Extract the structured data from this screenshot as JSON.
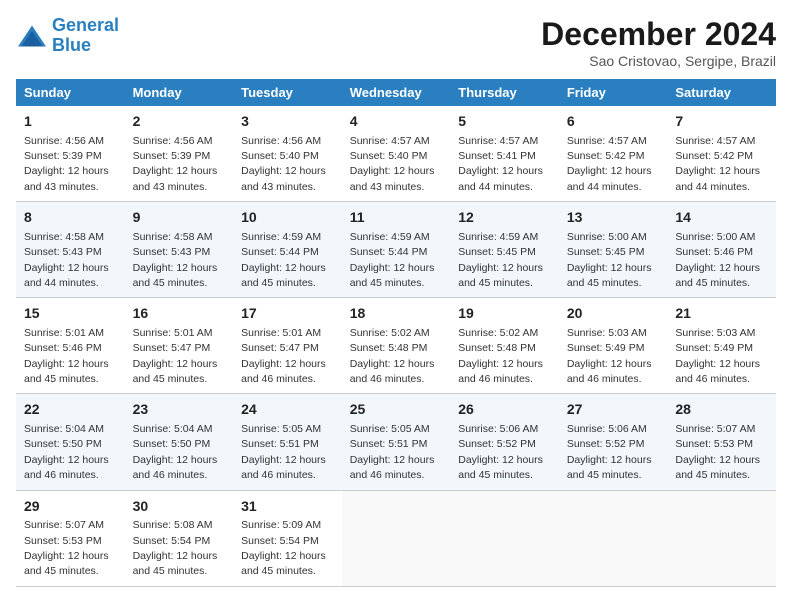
{
  "header": {
    "logo_line1": "General",
    "logo_line2": "Blue",
    "month": "December 2024",
    "location": "Sao Cristovao, Sergipe, Brazil"
  },
  "days_of_week": [
    "Sunday",
    "Monday",
    "Tuesday",
    "Wednesday",
    "Thursday",
    "Friday",
    "Saturday"
  ],
  "weeks": [
    [
      {
        "day": "1",
        "sunrise": "4:56 AM",
        "sunset": "5:39 PM",
        "daylight": "12 hours and 43 minutes."
      },
      {
        "day": "2",
        "sunrise": "4:56 AM",
        "sunset": "5:39 PM",
        "daylight": "12 hours and 43 minutes."
      },
      {
        "day": "3",
        "sunrise": "4:56 AM",
        "sunset": "5:40 PM",
        "daylight": "12 hours and 43 minutes."
      },
      {
        "day": "4",
        "sunrise": "4:57 AM",
        "sunset": "5:40 PM",
        "daylight": "12 hours and 43 minutes."
      },
      {
        "day": "5",
        "sunrise": "4:57 AM",
        "sunset": "5:41 PM",
        "daylight": "12 hours and 44 minutes."
      },
      {
        "day": "6",
        "sunrise": "4:57 AM",
        "sunset": "5:42 PM",
        "daylight": "12 hours and 44 minutes."
      },
      {
        "day": "7",
        "sunrise": "4:57 AM",
        "sunset": "5:42 PM",
        "daylight": "12 hours and 44 minutes."
      }
    ],
    [
      {
        "day": "8",
        "sunrise": "4:58 AM",
        "sunset": "5:43 PM",
        "daylight": "12 hours and 44 minutes."
      },
      {
        "day": "9",
        "sunrise": "4:58 AM",
        "sunset": "5:43 PM",
        "daylight": "12 hours and 45 minutes."
      },
      {
        "day": "10",
        "sunrise": "4:59 AM",
        "sunset": "5:44 PM",
        "daylight": "12 hours and 45 minutes."
      },
      {
        "day": "11",
        "sunrise": "4:59 AM",
        "sunset": "5:44 PM",
        "daylight": "12 hours and 45 minutes."
      },
      {
        "day": "12",
        "sunrise": "4:59 AM",
        "sunset": "5:45 PM",
        "daylight": "12 hours and 45 minutes."
      },
      {
        "day": "13",
        "sunrise": "5:00 AM",
        "sunset": "5:45 PM",
        "daylight": "12 hours and 45 minutes."
      },
      {
        "day": "14",
        "sunrise": "5:00 AM",
        "sunset": "5:46 PM",
        "daylight": "12 hours and 45 minutes."
      }
    ],
    [
      {
        "day": "15",
        "sunrise": "5:01 AM",
        "sunset": "5:46 PM",
        "daylight": "12 hours and 45 minutes."
      },
      {
        "day": "16",
        "sunrise": "5:01 AM",
        "sunset": "5:47 PM",
        "daylight": "12 hours and 45 minutes."
      },
      {
        "day": "17",
        "sunrise": "5:01 AM",
        "sunset": "5:47 PM",
        "daylight": "12 hours and 46 minutes."
      },
      {
        "day": "18",
        "sunrise": "5:02 AM",
        "sunset": "5:48 PM",
        "daylight": "12 hours and 46 minutes."
      },
      {
        "day": "19",
        "sunrise": "5:02 AM",
        "sunset": "5:48 PM",
        "daylight": "12 hours and 46 minutes."
      },
      {
        "day": "20",
        "sunrise": "5:03 AM",
        "sunset": "5:49 PM",
        "daylight": "12 hours and 46 minutes."
      },
      {
        "day": "21",
        "sunrise": "5:03 AM",
        "sunset": "5:49 PM",
        "daylight": "12 hours and 46 minutes."
      }
    ],
    [
      {
        "day": "22",
        "sunrise": "5:04 AM",
        "sunset": "5:50 PM",
        "daylight": "12 hours and 46 minutes."
      },
      {
        "day": "23",
        "sunrise": "5:04 AM",
        "sunset": "5:50 PM",
        "daylight": "12 hours and 46 minutes."
      },
      {
        "day": "24",
        "sunrise": "5:05 AM",
        "sunset": "5:51 PM",
        "daylight": "12 hours and 46 minutes."
      },
      {
        "day": "25",
        "sunrise": "5:05 AM",
        "sunset": "5:51 PM",
        "daylight": "12 hours and 46 minutes."
      },
      {
        "day": "26",
        "sunrise": "5:06 AM",
        "sunset": "5:52 PM",
        "daylight": "12 hours and 45 minutes."
      },
      {
        "day": "27",
        "sunrise": "5:06 AM",
        "sunset": "5:52 PM",
        "daylight": "12 hours and 45 minutes."
      },
      {
        "day": "28",
        "sunrise": "5:07 AM",
        "sunset": "5:53 PM",
        "daylight": "12 hours and 45 minutes."
      }
    ],
    [
      {
        "day": "29",
        "sunrise": "5:07 AM",
        "sunset": "5:53 PM",
        "daylight": "12 hours and 45 minutes."
      },
      {
        "day": "30",
        "sunrise": "5:08 AM",
        "sunset": "5:54 PM",
        "daylight": "12 hours and 45 minutes."
      },
      {
        "day": "31",
        "sunrise": "5:09 AM",
        "sunset": "5:54 PM",
        "daylight": "12 hours and 45 minutes."
      },
      null,
      null,
      null,
      null
    ]
  ]
}
